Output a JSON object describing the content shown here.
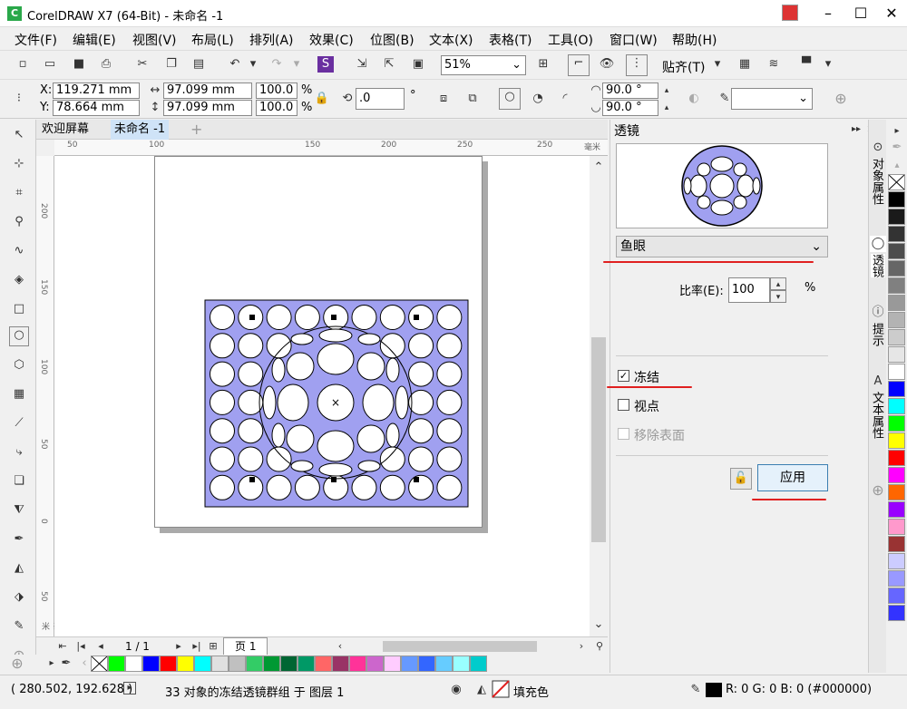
{
  "app": {
    "title": "CorelDRAW X7 (64-Bit) - 未命名 -1"
  },
  "menu": [
    "文件(F)",
    "编辑(E)",
    "视图(V)",
    "布局(L)",
    "排列(A)",
    "效果(C)",
    "位图(B)",
    "文本(X)",
    "表格(T)",
    "工具(O)",
    "窗口(W)",
    "帮助(H)"
  ],
  "toolbar": {
    "zoom": "51%",
    "snap_label": "贴齐(T)"
  },
  "props": {
    "x_label": "X:",
    "x": "119.271 mm",
    "y_label": "Y:",
    "y": "78.664 mm",
    "w": "97.099 mm",
    "h": "97.099 mm",
    "sx": "100.0",
    "sy": "100.0",
    "pct": "%",
    "rot": ".0",
    "deg": "°",
    "angle1": "90.0 °",
    "angle2": "90.0 °"
  },
  "tabs": [
    "欢迎屏幕",
    "未命名 -1"
  ],
  "ruler": {
    "h_ticks": [
      "50",
      "50",
      "100",
      "150",
      "200",
      "250"
    ],
    "unit": "毫米",
    "v_ticks": [
      "200",
      "150",
      "100",
      "50",
      "0"
    ]
  },
  "page_nav": {
    "pages": "1 / 1",
    "page_tab": "页 1"
  },
  "docker": {
    "title": "透镜",
    "lens_type": "鱼眼",
    "ratio_label": "比率(E):",
    "ratio_value": "100",
    "ratio_unit": "%",
    "freeze_label": "冻结",
    "freeze_checked": true,
    "viewpoint_label": "视点",
    "viewpoint_checked": false,
    "remove_face_label": "移除表面",
    "apply_label": "应用"
  },
  "side_tabs": [
    "对象属性",
    "透镜",
    "提示",
    "文本属性"
  ],
  "status": {
    "coords": "( 280.502, 192.628 )",
    "message": "33 对象的冻结透镜群组 于 图层 1",
    "fill_label": "填充色",
    "outline": "R: 0 G: 0 B: 0 (#000000)"
  },
  "colors": {
    "accent": "#a0a0f0",
    "red_underline": "#e02020"
  }
}
